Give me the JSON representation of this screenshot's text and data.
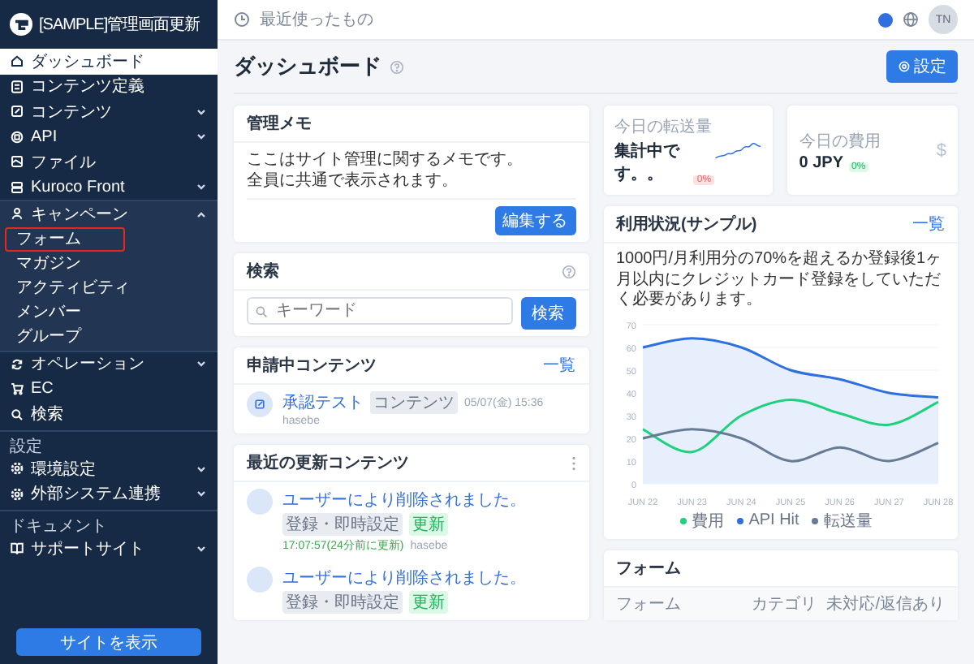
{
  "brand": {
    "title": "[SAMPLE]管理画面更新"
  },
  "sidebar": {
    "items": [
      {
        "kind": "item",
        "label": "ダッシュボード",
        "selected": true,
        "expandable": false
      },
      {
        "kind": "item",
        "label": "コンテンツ定義",
        "selected": false,
        "expandable": false
      },
      {
        "kind": "item",
        "label": "コンテンツ",
        "selected": false,
        "expandable": true
      },
      {
        "kind": "item",
        "label": "API",
        "selected": false,
        "expandable": true
      },
      {
        "kind": "item",
        "label": "ファイル",
        "selected": false,
        "expandable": false
      },
      {
        "kind": "item",
        "label": "Kuroco Front",
        "selected": false,
        "expandable": true
      },
      {
        "kind": "group",
        "label": "キャンペーン",
        "expanded": true,
        "children": [
          {
            "label": "フォーム",
            "highlighted": true
          },
          {
            "label": "マガジン",
            "highlighted": false
          },
          {
            "label": "アクティビティ",
            "highlighted": false
          },
          {
            "label": "メンバー",
            "highlighted": false
          },
          {
            "label": "グループ",
            "highlighted": false
          }
        ]
      },
      {
        "kind": "item",
        "label": "オペレーション",
        "selected": false,
        "expandable": true
      },
      {
        "kind": "item",
        "label": "EC",
        "selected": false,
        "expandable": false
      },
      {
        "kind": "item",
        "label": "検索",
        "selected": false,
        "expandable": false
      },
      {
        "kind": "heading",
        "label": "設定"
      },
      {
        "kind": "item",
        "label": "環境設定",
        "selected": false,
        "expandable": true
      },
      {
        "kind": "item",
        "label": "外部システム連携",
        "selected": false,
        "expandable": true
      },
      {
        "kind": "heading",
        "label": "ドキュメント"
      },
      {
        "kind": "item",
        "label": "サポートサイト",
        "selected": false,
        "expandable": true
      }
    ],
    "button": "サイトを表示"
  },
  "topbar": {
    "recent": "最近使ったもの",
    "avatar": "TN"
  },
  "page": {
    "title": "ダッシュボード",
    "settings_button": "設定"
  },
  "memo": {
    "title": "管理メモ",
    "lines": [
      "ここはサイト管理に関するメモです。",
      "全員に共通で表示されます。"
    ],
    "button": "編集する"
  },
  "search": {
    "title": "検索",
    "placeholder": "キーワード",
    "button": "検索"
  },
  "pending": {
    "title": "申請中コンテンツ",
    "link": "一覧",
    "items": [
      {
        "title": "承認テスト",
        "tag": "コンテンツ",
        "time": "05/07(金) 15:36",
        "user": "hasebe"
      }
    ]
  },
  "recent_updates": {
    "title": "最近の更新コンテンツ",
    "items": [
      {
        "title": "ユーザーにより削除されました。",
        "tags": [
          {
            "label": "登録・即時設定",
            "kind": "gray"
          },
          {
            "label": "更新",
            "kind": "green"
          }
        ],
        "time": "17:07:57(24分前に更新)",
        "user": "hasebe"
      },
      {
        "title": "ユーザーにより削除されました。",
        "tags": [
          {
            "label": "登録・即時設定",
            "kind": "gray"
          },
          {
            "label": "更新",
            "kind": "green"
          }
        ]
      }
    ]
  },
  "stats": [
    {
      "label": "今日の転送量",
      "value": "集計中です。。",
      "badge": "0%"
    },
    {
      "label": "今日の費用",
      "value": "0 JPY",
      "badge": "0%",
      "symbol": "$"
    }
  ],
  "usage": {
    "title": "利用状況(サンプル)",
    "link": "一覧",
    "text": "1000円/月利用分の70%を超えるか登録後1ヶ月以内にクレジットカード登録をしていただく必要があります。",
    "chart_data": {
      "type": "line",
      "grid": true,
      "categories": [
        "JUN 22",
        "JUN 23",
        "JUN 24",
        "JUN 25",
        "JUN 26",
        "JUN 27",
        "JUN 28"
      ],
      "ylim": [
        0,
        70
      ],
      "yticks": [
        0,
        10,
        20,
        30,
        40,
        50,
        60,
        70
      ],
      "series": [
        {
          "name": "費用",
          "color": "#1fd17d",
          "values": [
            24,
            14,
            30,
            37,
            31,
            26,
            36
          ]
        },
        {
          "name": "API Hit",
          "type": "area",
          "color": "#2f6fe0",
          "values": [
            60,
            64,
            60,
            50,
            46,
            40,
            38
          ]
        },
        {
          "name": "転送量",
          "color": "#687b95",
          "values": [
            20,
            24,
            20,
            10,
            16,
            10,
            18
          ]
        }
      ]
    }
  },
  "forms": {
    "title": "フォーム",
    "columns": [
      "フォーム",
      "カテゴリ",
      "未対応/返信あり"
    ]
  }
}
